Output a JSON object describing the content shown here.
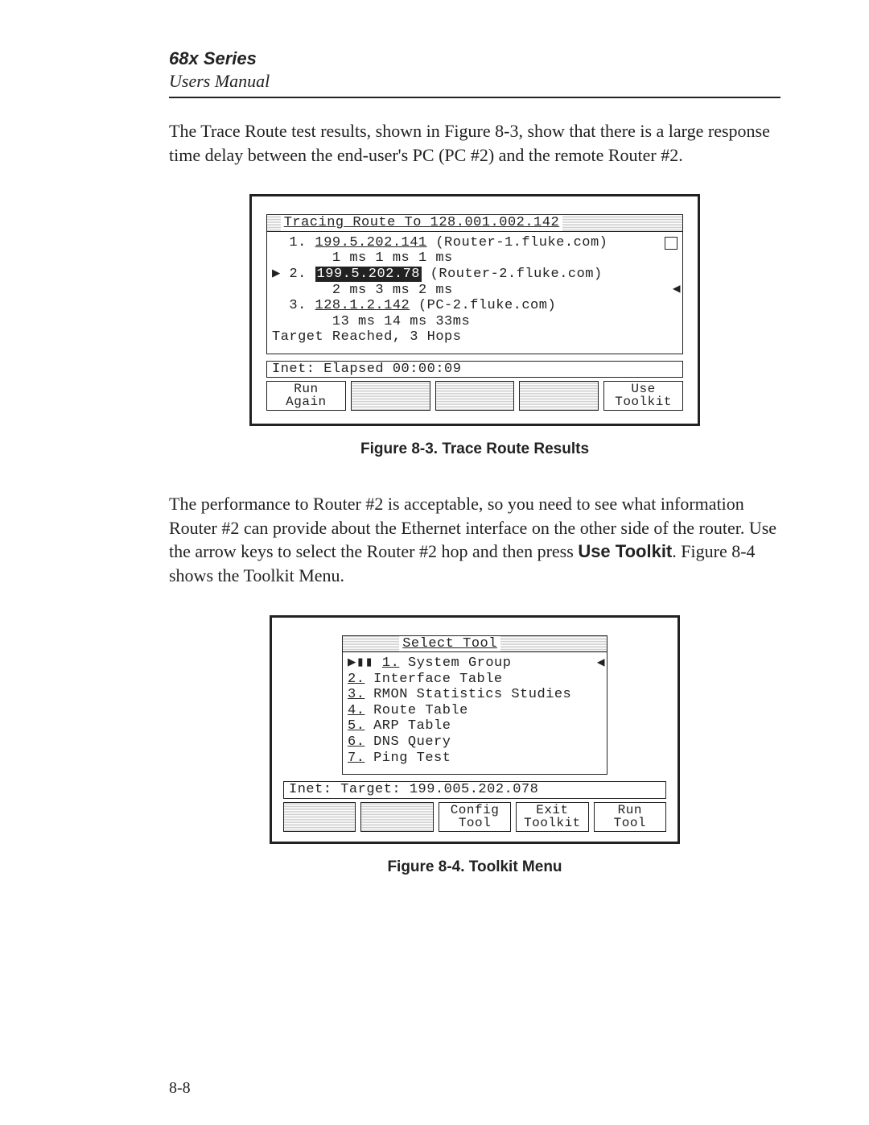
{
  "header": {
    "series": "68x Series",
    "manual": "Users Manual"
  },
  "para1": "The Trace Route test results, shown in Figure 8-3, show that there is a large response time delay between the end-user's PC (PC #2) and the remote Router #2.",
  "fig83": {
    "title": "Tracing Route To 128.001.002.142",
    "hops": [
      {
        "idx": "1.",
        "ip": "199.5.202.141",
        "host": "(Router-1.fluke.com)",
        "times": "1 ms 1 ms 1 ms",
        "selected": false
      },
      {
        "idx": "2.",
        "ip": "199.5.202.78",
        "host": "(Router-2.fluke.com)",
        "times": "2 ms 3 ms 2 ms",
        "selected": true
      },
      {
        "idx": "3.",
        "ip": "128.1.2.142",
        "host": "(PC-2.fluke.com)",
        "times": "13 ms 14 ms 33ms",
        "selected": false
      }
    ],
    "summary": "Target Reached, 3 Hops",
    "status": "Inet: Elapsed 00:00:09",
    "softkeys": [
      "Run\nAgain",
      "",
      "",
      "",
      "Use\nToolkit"
    ],
    "caption": "Figure 8-3.  Trace Route Results"
  },
  "para2_a": "The performance to Router #2 is acceptable, so you need to see what information Router #2 can provide about the Ethernet interface on the other side of the router.  Use the arrow keys to select the Router #2 hop and then press ",
  "para2_kw": "Use Toolkit",
  "para2_b": ".  Figure 8-4 shows the Toolkit Menu.",
  "fig84": {
    "title": "Select Tool",
    "items": [
      {
        "idx": "1.",
        "label": "System Group",
        "marker": "▶▮▮",
        "selected": true
      },
      {
        "idx": "2.",
        "label": "Interface Table"
      },
      {
        "idx": "3.",
        "label": "RMON Statistics Studies"
      },
      {
        "idx": "4.",
        "label": "Route Table"
      },
      {
        "idx": "5.",
        "label": "ARP Table"
      },
      {
        "idx": "6.",
        "label": "DNS Query"
      },
      {
        "idx": "7.",
        "label": "Ping Test"
      }
    ],
    "status": "Inet: Target: 199.005.202.078",
    "softkeys": [
      "",
      "",
      "Config\nTool",
      "Exit\nToolkit",
      "Run\nTool"
    ],
    "caption": "Figure 8-4.  Toolkit Menu"
  },
  "pagenum": "8-8"
}
